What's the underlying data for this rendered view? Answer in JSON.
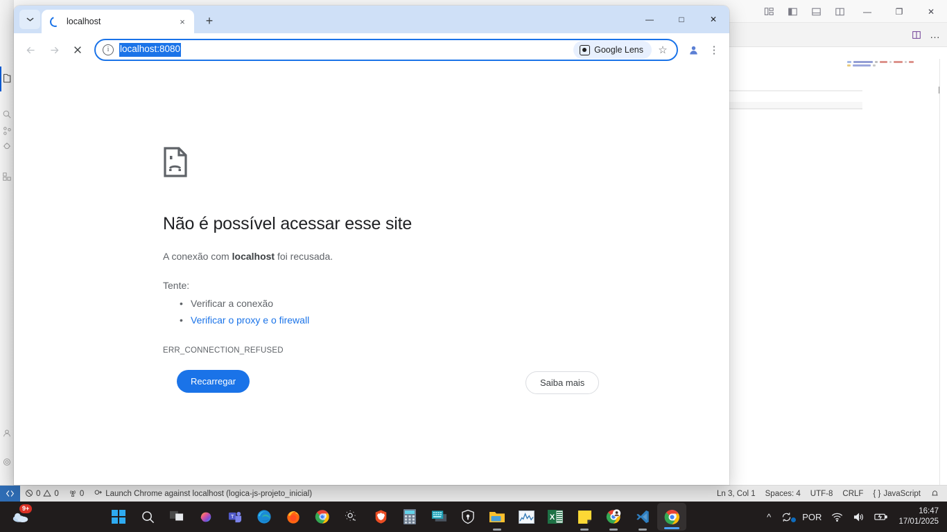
{
  "browser": {
    "tab": {
      "title": "localhost",
      "loading": true,
      "close_label": "×"
    },
    "tab_search_icon": "chevron-down-icon",
    "new_tab_label": "+",
    "window_controls": {
      "minimize": "—",
      "maximize": "□",
      "close": "✕"
    },
    "nav": {
      "back": "←",
      "forward": "→",
      "stop": "✕"
    },
    "omnibox": {
      "info_icon": "ⓘ",
      "url": "localhost:8080",
      "selected": true,
      "lens_label": "Google Lens",
      "bookmark_icon": "☆"
    },
    "profile_icon": "person-icon",
    "menu_icon": "⋮"
  },
  "error_page": {
    "icon": "sad-document-icon",
    "heading": "Não é possível acessar esse site",
    "subtitle_prefix": "A conexão com ",
    "subtitle_host": "localhost",
    "subtitle_suffix": " foi recusada.",
    "try_label": "Tente:",
    "suggestions": [
      {
        "text": "Verificar a conexão",
        "is_link": false
      },
      {
        "text": "Verificar o proxy e o firewall",
        "is_link": true
      }
    ],
    "error_code": "ERR_CONNECTION_REFUSED",
    "reload_button": "Recarregar",
    "learn_more_button": "Saiba mais"
  },
  "vscode": {
    "titlebar": {
      "logo_icon": "vscode-logo-icon",
      "layout_buttons": [
        "customize-layout-icon",
        "toggle-primary-sidebar-icon",
        "toggle-panel-icon",
        "toggle-secondary-sidebar-icon"
      ],
      "window_controls": {
        "minimize": "—",
        "restore": "❐",
        "close": "✕"
      }
    },
    "tabbar": {
      "split_editor_icon": "split-editor-icon",
      "more_actions_icon": "…"
    },
    "activity_bar": [
      "explorer-icon",
      "search-icon",
      "source-control-icon",
      "run-debug-icon",
      "extensions-icon",
      "accounts-icon",
      "settings-icon"
    ],
    "statusbar": {
      "remote_icon": "remote-window-icon",
      "errors_icon": "error-icon",
      "errors": "0",
      "warnings_icon": "warning-icon",
      "warnings": "0",
      "ports_icon": "radio-tower-icon",
      "ports": "0",
      "launch_icon": "debug-alt-icon",
      "launch_label": "Launch Chrome against localhost (logica-js-projeto_inicial)",
      "cursor": "Ln 3, Col 1",
      "spaces": "Spaces: 4",
      "encoding": "UTF-8",
      "eol": "CRLF",
      "language_icon": "{ }",
      "language": "JavaScript",
      "bell_icon": "notification-bell-icon"
    }
  },
  "taskbar": {
    "weather": {
      "badge": "9+",
      "icon": "weather-cloud-icon"
    },
    "apps": [
      {
        "name": "start-button",
        "icon": "windows-logo-icon",
        "running": false,
        "active": false
      },
      {
        "name": "search-button",
        "icon": "search-icon",
        "running": false,
        "active": false
      },
      {
        "name": "task-view-button",
        "icon": "task-view-icon",
        "running": false,
        "active": false
      },
      {
        "name": "copilot-button",
        "icon": "copilot-icon",
        "running": false,
        "active": false
      },
      {
        "name": "teams-button",
        "icon": "teams-icon",
        "running": false,
        "active": false
      },
      {
        "name": "edge-button",
        "icon": "edge-icon",
        "running": false,
        "active": false
      },
      {
        "name": "firefox-button",
        "icon": "firefox-icon",
        "running": false,
        "active": false
      },
      {
        "name": "chrome-button",
        "icon": "chrome-icon",
        "running": false,
        "active": false
      },
      {
        "name": "settings-button",
        "icon": "settings-gear-icon",
        "running": false,
        "active": false
      },
      {
        "name": "brave-button",
        "icon": "brave-icon",
        "running": false,
        "active": false
      },
      {
        "name": "calculator-button",
        "icon": "calculator-icon",
        "running": false,
        "active": false
      },
      {
        "name": "terminal-button",
        "icon": "terminal-icon",
        "running": false,
        "active": false
      },
      {
        "name": "bitwarden-button",
        "icon": "lock-shield-icon",
        "running": false,
        "active": false
      },
      {
        "name": "file-explorer-button",
        "icon": "folder-icon",
        "running": true,
        "active": false
      },
      {
        "name": "task-manager-button",
        "icon": "chart-monitor-icon",
        "running": false,
        "active": false
      },
      {
        "name": "excel-button",
        "icon": "excel-icon",
        "running": false,
        "active": false
      },
      {
        "name": "sticky-notes-button",
        "icon": "sticky-note-icon",
        "running": true,
        "active": false
      },
      {
        "name": "chrome-profile-button",
        "icon": "chrome-avatar-icon",
        "running": true,
        "active": false
      },
      {
        "name": "vscode-button",
        "icon": "vscode-icon",
        "running": true,
        "active": false
      },
      {
        "name": "chrome-active-button",
        "icon": "chrome-icon",
        "running": true,
        "active": true
      }
    ],
    "tray": {
      "overflow_icon": "^",
      "sync_icon": "onedrive-sync-icon",
      "language": "POR",
      "wifi_icon": "wifi-icon",
      "volume_icon": "speaker-icon",
      "battery_icon": "battery-charging-icon",
      "time": "16:47",
      "date": "17/01/2025"
    }
  },
  "colors": {
    "accent_blue": "#1a73e8",
    "tab_strip": "#cfe0f7",
    "taskbar": "#201c1c",
    "status_bar": "#e7e7e7",
    "link": "#1a73e8"
  }
}
